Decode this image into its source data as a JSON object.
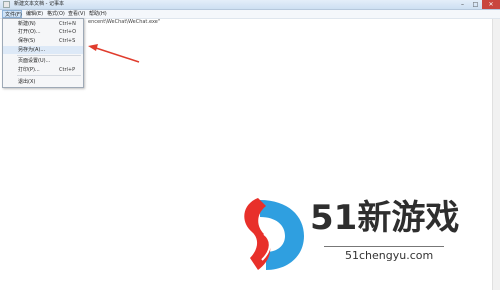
{
  "window": {
    "title": "新建文本文档 - 记事本"
  },
  "menubar": {
    "items": [
      {
        "label": "文件(F)"
      },
      {
        "label": "编辑(E)"
      },
      {
        "label": "格式(O)"
      },
      {
        "label": "查看(V)"
      },
      {
        "label": "帮助(H)"
      }
    ]
  },
  "editor": {
    "text": "encent\\WeChat\\WeChat.exe\""
  },
  "file_menu": {
    "items": [
      {
        "label": "新建(N)",
        "shortcut": "Ctrl+N"
      },
      {
        "label": "打开(O)...",
        "shortcut": "Ctrl+O"
      },
      {
        "label": "保存(S)",
        "shortcut": "Ctrl+S"
      },
      {
        "label": "另存为(A)...",
        "shortcut": ""
      },
      {
        "label": "页面设置(U)...",
        "shortcut": ""
      },
      {
        "label": "打印(P)...",
        "shortcut": "Ctrl+P"
      },
      {
        "label": "退出(X)",
        "shortcut": ""
      }
    ]
  },
  "watermark": {
    "brand": "51新游戏",
    "url": "51chengyu.com"
  },
  "colors": {
    "arrow": "#e03c2d",
    "logo_red": "#e8302a",
    "logo_blue": "#2f9fe0"
  }
}
